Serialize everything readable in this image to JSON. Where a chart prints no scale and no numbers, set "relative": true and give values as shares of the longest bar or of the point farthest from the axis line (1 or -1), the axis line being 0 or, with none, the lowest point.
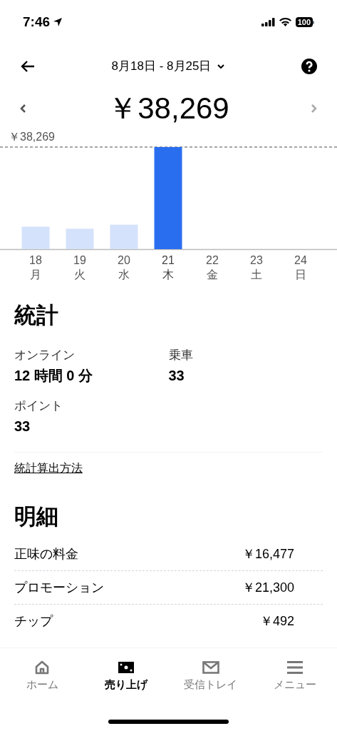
{
  "status_bar": {
    "time": "7:46",
    "battery": "100"
  },
  "header": {
    "date_range": "8月18日 - 8月25日"
  },
  "total": "￥38,269",
  "chart": {
    "days": [
      {
        "weekday": "月",
        "selected": false
      },
      {
        "weekday": "火",
        "selected": false
      },
      {
        "weekday": "水",
        "selected": false
      },
      {
        "weekday": "木",
        "selected": true
      },
      {
        "weekday": "金",
        "selected": false
      },
      {
        "weekday": "土",
        "selected": false
      },
      {
        "weekday": "日",
        "selected": false
      }
    ],
    "chart_data": {
      "type": "bar",
      "categories": [
        "18",
        "19",
        "20",
        "21",
        "22",
        "23",
        "24"
      ],
      "relative": true,
      "series": [
        {
          "values": [
            0.22,
            0.2,
            0.24,
            1,
            0,
            0,
            0
          ]
        }
      ],
      "annotations": [
        "￥38,269"
      ]
    }
  },
  "stats": {
    "title": "統計",
    "items": [
      {
        "label": "オンライン",
        "value": "12 時間 0 分"
      },
      {
        "label": "乗車",
        "value": "33"
      },
      {
        "label": "ポイント",
        "value": "33"
      }
    ],
    "link": "統計算出方法"
  },
  "details": {
    "title": "明細",
    "rows": [
      {
        "label": "正味の料金",
        "amount": "￥16,477"
      },
      {
        "label": "プロモーション",
        "amount": "￥21,300"
      },
      {
        "label": "チップ",
        "amount": "￥492"
      }
    ]
  },
  "tab_bar": [
    {
      "label": "ホーム",
      "kind": "home",
      "selected": false
    },
    {
      "label": "売り上げ",
      "kind": "earnings",
      "selected": true
    },
    {
      "label": "受信トレイ",
      "kind": "inbox",
      "selected": false
    },
    {
      "label": "メニュー",
      "kind": "menu",
      "selected": false
    }
  ]
}
